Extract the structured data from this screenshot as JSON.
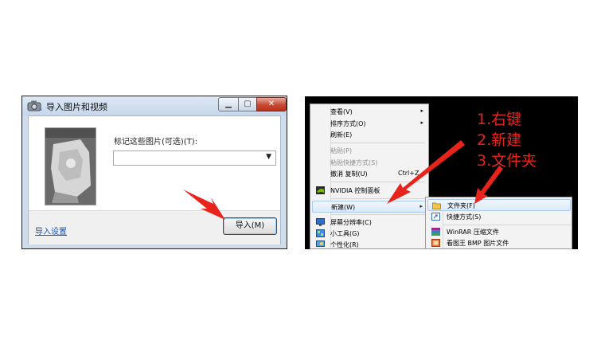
{
  "import_dialog": {
    "title": "导入图片和视频",
    "window_controls": {
      "minimize": "▁",
      "maximize": "▢",
      "close": "✕"
    },
    "tag_label": "标记这些图片(可选)(T):",
    "tag_value": "",
    "import_settings_link": "导入设置",
    "import_button": "导入(M)",
    "icons": {
      "title": "camera-icon",
      "dropdown": "chevron-down-icon",
      "thumbnail": "photo-thumbnail"
    }
  },
  "context_menu": {
    "items": [
      {
        "label": "查看(V)",
        "has_submenu": true,
        "disabled": false
      },
      {
        "label": "排序方式(O)",
        "has_submenu": true,
        "disabled": false
      },
      {
        "label": "刷新(E)",
        "has_submenu": false,
        "disabled": false
      },
      {
        "label": "粘贴(P)",
        "has_submenu": false,
        "disabled": true
      },
      {
        "label": "粘贴快捷方式(S)",
        "has_submenu": false,
        "disabled": true
      },
      {
        "label": "撤消 复制(U)",
        "shortcut": "Ctrl+Z",
        "has_submenu": false,
        "disabled": false
      },
      {
        "label": "NVIDIA 控制面板",
        "has_submenu": false,
        "disabled": false,
        "icon": "nvidia-icon"
      },
      {
        "label": "新建(W)",
        "has_submenu": true,
        "disabled": false,
        "highlighted": true
      },
      {
        "label": "屏幕分辨率(C)",
        "has_submenu": false,
        "disabled": false,
        "icon": "display-icon"
      },
      {
        "label": "小工具(G)",
        "has_submenu": false,
        "disabled": false,
        "icon": "gadget-icon"
      },
      {
        "label": "个性化(R)",
        "has_submenu": false,
        "disabled": false,
        "icon": "personalize-icon"
      }
    ],
    "arrow_glyph": "▸"
  },
  "new_submenu": {
    "items": [
      {
        "label": "文件夹(F)",
        "icon": "folder-icon",
        "highlighted": true
      },
      {
        "label": "快捷方式(S)",
        "icon": "shortcut-icon"
      },
      {
        "label": "WinRAR 压缩文件",
        "icon": "winrar-icon"
      },
      {
        "label": "看图王 BMP 图片文件",
        "icon": "image-file-icon"
      }
    ]
  },
  "annotations": {
    "step1": "1.右键",
    "step2": "2.新建",
    "step3": "3.文件夹",
    "color": "#e8231c"
  }
}
